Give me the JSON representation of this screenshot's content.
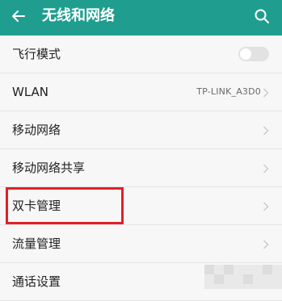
{
  "header": {
    "title": "无线和网络",
    "back_icon": "arrow-left-icon",
    "search_icon": "search-icon",
    "accent_color": "#1f9e8f"
  },
  "list": {
    "items": [
      {
        "label": "飞行模式",
        "type": "toggle",
        "toggle_on": false
      },
      {
        "label": "WLAN",
        "type": "value",
        "value": "TP-LINK_A3D0"
      },
      {
        "label": "移动网络",
        "type": "chevron"
      },
      {
        "label": "移动网络共享",
        "type": "chevron"
      },
      {
        "label": "双卡管理",
        "type": "chevron",
        "highlighted": true
      },
      {
        "label": "流量管理",
        "type": "chevron"
      },
      {
        "label": "通话设置",
        "type": "chevron"
      }
    ]
  },
  "highlight": {
    "color": "#e0202a",
    "target": "双卡管理"
  }
}
